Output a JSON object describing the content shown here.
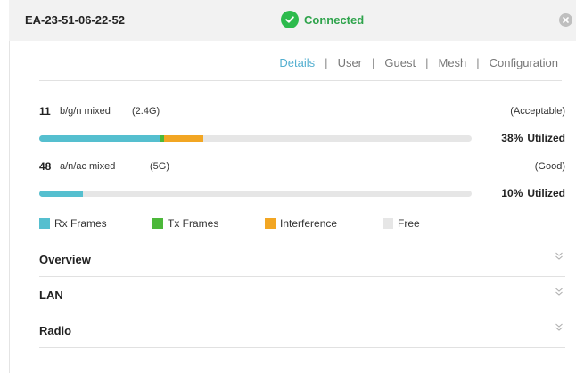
{
  "header": {
    "device_name": "EA-23-51-06-22-52",
    "status": "Connected",
    "status_color": "#2dbb4d"
  },
  "tabs": [
    {
      "label": "Details",
      "active": true
    },
    {
      "label": "User",
      "active": false
    },
    {
      "label": "Guest",
      "active": false
    },
    {
      "label": "Mesh",
      "active": false
    },
    {
      "label": "Configuration",
      "active": false
    }
  ],
  "channels": [
    {
      "channel": "11",
      "mode": "b/g/n mixed",
      "band": "(2.4G)",
      "quality": "(Acceptable)",
      "utilization_pct": "38%",
      "utilization_label": "Utilized",
      "segments": {
        "rx": 0.28,
        "tx": 0.008,
        "interference": 0.092
      }
    },
    {
      "channel": "48",
      "mode": "a/n/ac mixed",
      "band": "(5G)",
      "quality": "(Good)",
      "utilization_pct": "10%",
      "utilization_label": "Utilized",
      "segments": {
        "rx": 0.1,
        "tx": 0.0,
        "interference": 0.0
      }
    }
  ],
  "legend": [
    {
      "label": "Rx Frames",
      "color": "#55bfcf"
    },
    {
      "label": "Tx Frames",
      "color": "#4cb83a"
    },
    {
      "label": "Interference",
      "color": "#f2a623"
    },
    {
      "label": "Free",
      "color": "#e6e6e6"
    }
  ],
  "sections": [
    {
      "title": "Overview"
    },
    {
      "title": "LAN"
    },
    {
      "title": "Radio"
    }
  ]
}
